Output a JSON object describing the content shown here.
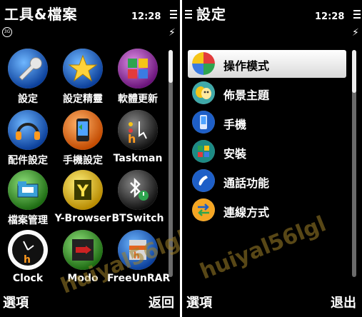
{
  "left_screen": {
    "title": "工具&檔案",
    "time": "12:28",
    "apps": [
      {
        "label": "設定",
        "icon": "wrench-icon"
      },
      {
        "label": "設定精靈",
        "icon": "star-wizard-icon"
      },
      {
        "label": "軟體更新",
        "icon": "software-update-icon"
      },
      {
        "label": "配件設定",
        "icon": "headset-icon"
      },
      {
        "label": "手機設定",
        "icon": "phone-setup-icon"
      },
      {
        "label": "Taskman",
        "icon": "taskman-icon"
      },
      {
        "label": "檔案管理",
        "icon": "file-manager-icon"
      },
      {
        "label": "Y-Browser",
        "icon": "y-browser-icon"
      },
      {
        "label": "BTSwitch",
        "icon": "bluetooth-switch-icon"
      },
      {
        "label": "Clock",
        "icon": "clock-icon"
      },
      {
        "label": "Modo",
        "icon": "modo-icon"
      },
      {
        "label": "FreeUnRAR",
        "icon": "freeunrar-icon"
      }
    ],
    "softkey_left": "選項",
    "softkey_right": "返回",
    "watermark": "huiyal56lgl"
  },
  "right_screen": {
    "title": "設定",
    "time": "12:28",
    "items": [
      {
        "label": "操作模式",
        "icon": "operation-mode-icon",
        "selected": true
      },
      {
        "label": "佈景主題",
        "icon": "theme-mask-icon",
        "selected": false
      },
      {
        "label": "手機",
        "icon": "mobile-phone-icon",
        "selected": false
      },
      {
        "label": "安裝",
        "icon": "installation-icon",
        "selected": false
      },
      {
        "label": "通話功能",
        "icon": "call-handset-icon",
        "selected": false
      },
      {
        "label": "連線方式",
        "icon": "connectivity-arrows-icon",
        "selected": false
      }
    ],
    "softkey_left": "選項",
    "softkey_right": "退出",
    "watermark": "huiyal56lgl"
  },
  "colors": {
    "background": "#000000",
    "selection": "#eeeeee",
    "scroll_track": "#6a6a6a",
    "scroll_thumb": "#ededed"
  }
}
